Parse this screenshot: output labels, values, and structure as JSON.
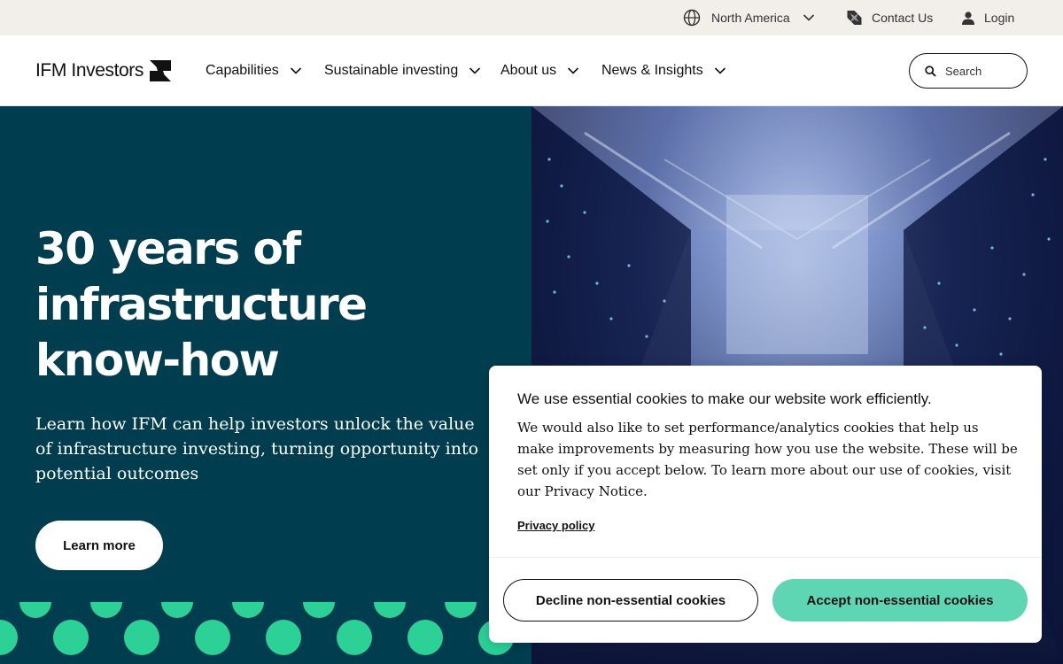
{
  "utility_bar": {
    "region_label": "North America",
    "contact_label": "Contact Us",
    "login_label": "Login"
  },
  "header": {
    "logo_text": "IFM Investors",
    "nav": [
      {
        "label": "Capabilities"
      },
      {
        "label": "Sustainable investing"
      },
      {
        "label": "About us"
      },
      {
        "label": "News & Insights"
      }
    ],
    "search_placeholder": "Search"
  },
  "hero": {
    "title": "30 years of infrastructure know-how",
    "subtitle": "Learn how IFM can help investors unlock the value of infrastructure investing, turning opportunity into potential outcomes",
    "cta_label": "Learn more"
  },
  "cookie_banner": {
    "heading": "We use essential cookies to make our website work efficiently.",
    "body": "We would also like to set performance/analytics cookies that help us make improvements by measuring how you use the website. These will be set only if you accept below. To learn more about our use of cookies, visit our Privacy Notice.",
    "privacy_link": "Privacy policy",
    "decline_label": "Decline non-essential cookies",
    "accept_label": "Accept non-essential cookies"
  },
  "colors": {
    "hero_bg": "#003e4f",
    "accent_green": "#5ed6b4",
    "dot_green": "#2bd197",
    "utility_bg": "#f2efeb"
  },
  "icons": {
    "region": "globe-icon",
    "contact": "logo-mark-icon",
    "login": "user-icon",
    "search": "search-icon",
    "dropdown": "chevron-down-icon"
  }
}
